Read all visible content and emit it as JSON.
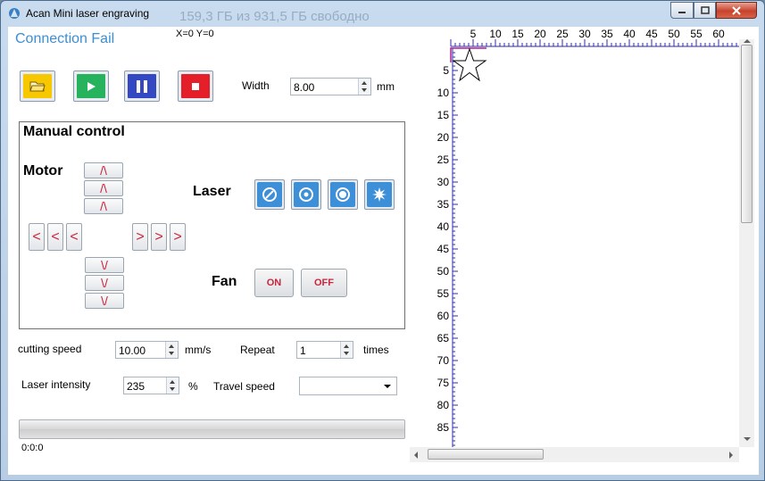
{
  "window": {
    "title": "Acan Mini laser engraving",
    "background_text": "159,3 ГБ из 931,5 ГБ свободно",
    "controls": {
      "minimize": "minimize",
      "maximize": "maximize",
      "close": "close"
    }
  },
  "status": {
    "connection": "Connection Fail",
    "coords": "X=0 Y=0"
  },
  "toolbar": {
    "buttons": [
      {
        "icon": "open-folder-icon",
        "color": "#f7c800"
      },
      {
        "icon": "play-icon",
        "color": "#27b35e"
      },
      {
        "icon": "pause-icon",
        "color": "#3448c4"
      },
      {
        "icon": "stop-icon",
        "color": "#e41f2a"
      }
    ],
    "width_label": "Width",
    "width_value": "8.00",
    "width_unit": "mm"
  },
  "manual": {
    "title": "Manual control",
    "motor_label": "Motor",
    "laser_label": "Laser",
    "fan_label": "Fan",
    "up": "/\\",
    "down": "\\/",
    "left": "<",
    "right": ">",
    "laser_buttons": [
      "laser-off-icon",
      "laser-low-icon",
      "laser-focus-icon",
      "laser-burst-icon"
    ],
    "fan_on": "ON",
    "fan_off": "OFF"
  },
  "settings": {
    "cutting_speed_label": "cutting speed",
    "cutting_speed_value": "10.00",
    "cutting_speed_unit": "mm/s",
    "repeat_label": "Repeat",
    "repeat_value": "1",
    "repeat_unit": "times",
    "intensity_label": "Laser intensity",
    "intensity_value": "235",
    "intensity_unit": "%",
    "travel_label": "Travel speed",
    "travel_value": ""
  },
  "progress": {
    "value": 0,
    "time": "0:0:0"
  },
  "ruler": {
    "top": [
      "5",
      "10",
      "15",
      "20",
      "25",
      "30",
      "35",
      "40",
      "45",
      "50",
      "55",
      "60"
    ],
    "left": [
      "5",
      "10",
      "15",
      "20",
      "25",
      "30",
      "35",
      "40",
      "45",
      "50",
      "55",
      "60",
      "65",
      "70",
      "75",
      "80",
      "85"
    ]
  },
  "colors": {
    "accent": "#3a8fd6",
    "jog_text": "#c8263e",
    "ruler": "#2b2bb0",
    "origin_marker": "#b0208a"
  }
}
